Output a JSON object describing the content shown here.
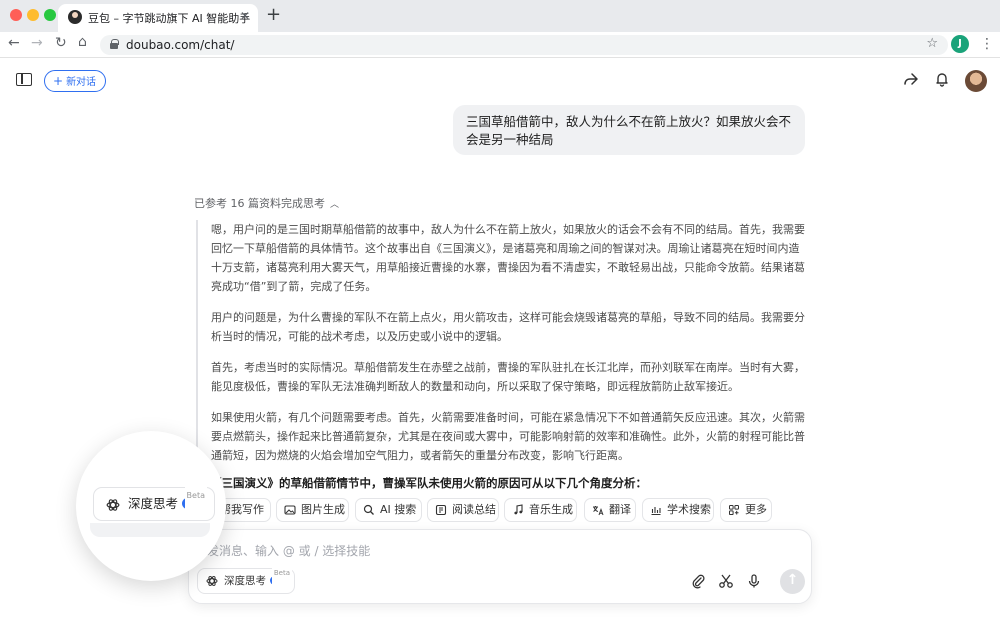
{
  "browser": {
    "tab_title": "豆包 – 字节跳动旗下 AI 智能助手",
    "url": "doubao.com/chat/",
    "profile_initial": "J",
    "traffic_colors": [
      "#ff5f57",
      "#febc2e",
      "#28c840"
    ]
  },
  "header": {
    "new_chat_label": "新对话"
  },
  "conversation": {
    "user_message": "三国草船借箭中，敌人为什么不在箭上放火？如果放火会不会是另一种结局",
    "references_label": "已参考 16 篇资料完成思考",
    "thinking_paragraphs": [
      "嗯，用户问的是三国时期草船借箭的故事中，敌人为什么不在箭上放火，如果放火的话会不会有不同的结局。首先，我需要回忆一下草船借箭的具体情节。这个故事出自《三国演义》，是诸葛亮和周瑜之间的智谋对决。周瑜让诸葛亮在短时间内造十万支箭，诸葛亮利用大雾天气，用草船接近曹操的水寨，曹操因为看不清虚实，不敢轻易出战，只能命令放箭。结果诸葛亮成功“借”到了箭，完成了任务。",
      "用户的问题是，为什么曹操的军队不在箭上点火，用火箭攻击，这样可能会烧毁诸葛亮的草船，导致不同的结局。我需要分析当时的情况，可能的战术考虑，以及历史或小说中的逻辑。",
      "首先，考虑当时的实际情况。草船借箭发生在赤壁之战前，曹操的军队驻扎在长江北岸，而孙刘联军在南岸。当时有大雾，能见度极低，曹操的军队无法准确判断敌人的数量和动向，所以采取了保守策略，即远程放箭防止敌军接近。",
      "如果使用火箭，有几个问题需要考虑。首先，火箭需要准备时间，可能在紧急情况下不如普通箭矢反应迅速。其次，火箭需要点燃箭头，操作起来比普通箭复杂，尤其是在夜间或大雾中，可能影响射箭的效率和准确性。此外，火箭的射程可能比普通箭短，因为燃烧的火焰会增加空气阻力，或者箭矢的重量分布改变，影响飞行距离。"
    ],
    "answer_intro": "《三国演义》的草船借箭情节中，曹操军队未使用火箭的原因可从以下几个角度分析："
  },
  "skills": [
    {
      "label": "帮我写作",
      "icon": "pen-icon"
    },
    {
      "label": "图片生成",
      "icon": "image-icon"
    },
    {
      "label": "AI 搜索",
      "icon": "search-icon"
    },
    {
      "label": "阅读总结",
      "icon": "read-icon"
    },
    {
      "label": "音乐生成",
      "icon": "music-icon"
    },
    {
      "label": "翻译",
      "icon": "translate-icon"
    },
    {
      "label": "学术搜索",
      "icon": "academic-icon"
    },
    {
      "label": "更多",
      "icon": "grid-icon"
    }
  ],
  "input": {
    "placeholder": "发消息、输入 @ 或 / 选择技能",
    "deep_think_label": "深度思考",
    "beta_badge": "Beta"
  },
  "colors": {
    "accent": "#2f6ff0"
  }
}
